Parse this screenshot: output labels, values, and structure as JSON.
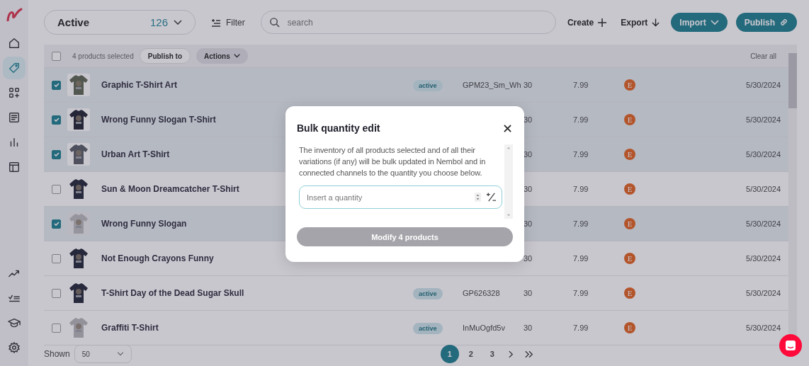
{
  "sidebar": {
    "items": [
      {
        "kind": "home",
        "selected": false
      },
      {
        "kind": "tag",
        "selected": true
      },
      {
        "kind": "apps",
        "selected": false
      },
      {
        "kind": "list",
        "selected": false
      },
      {
        "kind": "chart",
        "selected": false
      },
      {
        "kind": "layout",
        "selected": false
      },
      {
        "kind": "trend",
        "selected": false
      },
      {
        "kind": "checklist",
        "selected": false
      },
      {
        "kind": "cap",
        "selected": false
      },
      {
        "kind": "gear",
        "selected": false
      }
    ]
  },
  "toolbar": {
    "status_filter": {
      "label": "Active",
      "count": "126"
    },
    "filter": "Filter",
    "search": {
      "placeholder": "search"
    },
    "buttons": [
      {
        "label": "Create",
        "kind": "plain-plus"
      },
      {
        "label": "Export",
        "kind": "plain-down"
      },
      {
        "label": "Import",
        "kind": "solid-caret"
      },
      {
        "label": "Publish",
        "kind": "solid-link"
      }
    ]
  },
  "selection_bar": {
    "checked": false,
    "text": "4 products selected",
    "publish_to": "Publish to",
    "actions": "Actions",
    "clear": "Clear all"
  },
  "rows": [
    {
      "name": "Graphic T-Shirt Art",
      "checked": true,
      "status": "active",
      "sku": "GPM23_Sm_Wh",
      "quantity": "30",
      "price": "7.99",
      "channel": "E",
      "date": "5/30/2024"
    },
    {
      "name": "Wrong Funny Slogan T-Shirt",
      "checked": true,
      "quantity": "30",
      "price": "7.99",
      "channel": "E",
      "date": "5/30/2024"
    },
    {
      "name": "Urban Art T-Shirt",
      "checked": true,
      "quantity": "30",
      "price": "7.99",
      "channel": "E",
      "date": "5/30/2024"
    },
    {
      "name": "Sun & Moon Dreamcatcher T-Shirt",
      "checked": false,
      "quantity": "30",
      "price": "7.99",
      "channel": "E",
      "date": "5/30/2024"
    },
    {
      "name": "Wrong Funny Slogan",
      "checked": true,
      "quantity": "30",
      "price": "7.99",
      "channel": "E",
      "date": "5/30/2024"
    },
    {
      "name": "Not Enough Crayons Funny",
      "checked": false,
      "quantity": "30",
      "price": "7.99",
      "channel": "E",
      "date": "5/30/2024"
    },
    {
      "name": "T-Shirt Day of the Dead Sugar Skull",
      "checked": false,
      "status": "active",
      "sku": "GP626328",
      "quantity": "30",
      "price": "7.99",
      "channel": "E",
      "date": "5/30/2024"
    },
    {
      "name": "Graffiti T-Shirt",
      "checked": false,
      "status": "active",
      "sku": "InMuOgfd5v",
      "quantity": "30",
      "price": "7.99",
      "channel": "E",
      "date": "5/30/2024"
    }
  ],
  "footer": {
    "shown_label": "Shown",
    "shown_value": "50",
    "pages": [
      {
        "label": "1",
        "selected": true
      },
      {
        "label": "2",
        "selected": false
      },
      {
        "label": "3",
        "selected": false
      }
    ]
  },
  "modal": {
    "title": "Bulk quantity edit",
    "text": "The inventory of all products selected and of all their variations (if any) will be bulk updated in Nembol and in connected channels to the quantity you choose below.",
    "placeholder": "Insert a quantity",
    "button": {
      "label": "Modify 4 products",
      "disabled": true
    }
  }
}
